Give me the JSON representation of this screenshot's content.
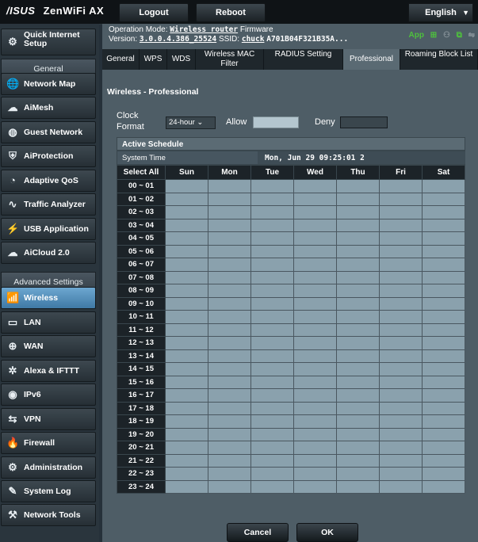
{
  "topbar": {
    "brand_logo": "/ISUS",
    "product": "ZenWiFi AX",
    "logout": "Logout",
    "reboot": "Reboot",
    "language": "English"
  },
  "sidebar": {
    "quick_setup": {
      "line1": "Quick Internet",
      "line2": "Setup"
    },
    "general_header": "General",
    "general_items": [
      {
        "label": "Network Map",
        "icon": "network-map-icon"
      },
      {
        "label": "AiMesh",
        "icon": "aimesh-icon"
      },
      {
        "label": "Guest Network",
        "icon": "guest-network-icon"
      },
      {
        "label": "AiProtection",
        "icon": "shield-icon"
      },
      {
        "label": "Adaptive QoS",
        "icon": "qos-gauge-icon"
      },
      {
        "label": "Traffic Analyzer",
        "icon": "traffic-analyzer-icon"
      },
      {
        "label": "USB Application",
        "icon": "usb-icon"
      },
      {
        "label": "AiCloud 2.0",
        "icon": "cloud-icon"
      }
    ],
    "advanced_header": "Advanced Settings",
    "advanced_items": [
      {
        "label": "Wireless",
        "icon": "wifi-icon",
        "active": true
      },
      {
        "label": "LAN",
        "icon": "lan-icon"
      },
      {
        "label": "WAN",
        "icon": "globe-icon"
      },
      {
        "label": "Alexa & IFTTT",
        "icon": "alexa-icon"
      },
      {
        "label": "IPv6",
        "icon": "ipv6-icon"
      },
      {
        "label": "VPN",
        "icon": "vpn-icon"
      },
      {
        "label": "Firewall",
        "icon": "firewall-icon"
      },
      {
        "label": "Administration",
        "icon": "admin-gear-icon"
      },
      {
        "label": "System Log",
        "icon": "system-log-icon"
      },
      {
        "label": "Network Tools",
        "icon": "network-tools-icon"
      }
    ]
  },
  "header": {
    "op_mode_label": "Operation Mode:",
    "op_mode_value": "Wireless router",
    "firmware_label": "Firmware",
    "version_label": "Version:",
    "version_value": "3.0.0.4.386_25524",
    "ssid_label": "SSID:",
    "ssid_value": "chuck",
    "ssid_extra": "A701B04F321B35A...",
    "app_label": "App"
  },
  "tabs": [
    {
      "label": "General"
    },
    {
      "label": "WPS"
    },
    {
      "label": "WDS"
    },
    {
      "label": "Wireless MAC Filter"
    },
    {
      "label": "RADIUS Setting"
    },
    {
      "label": "Professional",
      "active": true
    },
    {
      "label": "Roaming Block List"
    }
  ],
  "panel": {
    "title": "Wireless - Professional",
    "clock_format_label_1": "Clock",
    "clock_format_label_2": "Format",
    "clock_format_value": "24-hour",
    "allow_label": "Allow",
    "deny_label": "Deny",
    "schedule_header": "Active Schedule",
    "system_time_label": "System Time",
    "system_time_value": "Mon, Jun 29 09:25:01 2",
    "select_all": "Select All",
    "days": [
      "Sun",
      "Mon",
      "Tue",
      "Wed",
      "Thu",
      "Fri",
      "Sat"
    ],
    "hours": [
      "00 ~ 01",
      "01 ~ 02",
      "02 ~ 03",
      "03 ~ 04",
      "04 ~ 05",
      "05 ~ 06",
      "06 ~ 07",
      "07 ~ 08",
      "08 ~ 09",
      "09 ~ 10",
      "10 ~ 11",
      "11 ~ 12",
      "12 ~ 13",
      "13 ~ 14",
      "14 ~ 15",
      "15 ~ 16",
      "16 ~ 17",
      "17 ~ 18",
      "18 ~ 19",
      "19 ~ 20",
      "20 ~ 21",
      "21 ~ 22",
      "22 ~ 23",
      "23 ~ 24"
    ],
    "cancel": "Cancel",
    "ok": "OK"
  },
  "colors": {
    "allow": "#b4c6cf",
    "deny": "#3a464d",
    "active_nav": "#4f8ab6"
  }
}
